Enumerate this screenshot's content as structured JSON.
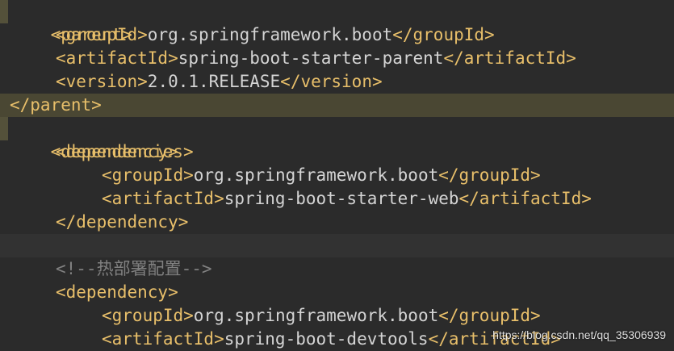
{
  "code_lines": [
    {
      "open": "<parent>",
      "text": "",
      "close": ""
    },
    {
      "open": "<groupId>",
      "text": "org.springframework.boot",
      "close": "</groupId>"
    },
    {
      "open": "<artifactId>",
      "text": "spring-boot-starter-parent",
      "close": "</artifactId>"
    },
    {
      "open": "<version>",
      "text": "2.0.1.RELEASE",
      "close": "</version>"
    },
    {
      "open": "</parent>",
      "text": "",
      "close": ""
    },
    {
      "open": "<dependencies>",
      "text": "",
      "close": ""
    },
    {
      "open": "<dependency>",
      "text": "",
      "close": ""
    },
    {
      "open": "<groupId>",
      "text": "org.springframework.boot",
      "close": "</groupId>"
    },
    {
      "open": "<artifactId>",
      "text": "spring-boot-starter-web",
      "close": "</artifactId>"
    },
    {
      "open": "</dependency>",
      "text": "",
      "close": ""
    },
    {
      "comment": ""
    },
    {
      "comment": "<!--热部署配置-->"
    },
    {
      "open": "<dependency>",
      "text": "",
      "close": ""
    },
    {
      "open": "<groupId>",
      "text": "org.springframework.boot",
      "close": "</groupId>"
    },
    {
      "open": "<artifactId>",
      "text": "spring-boot-devtools",
      "close": "</artifactId>"
    }
  ],
  "watermark": "https://blog.csdn.net/qq_35306939"
}
